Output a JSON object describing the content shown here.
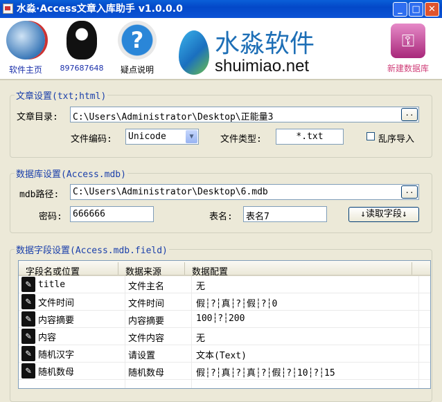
{
  "window": {
    "title": "水淼·Access文章入库助手 v1.0.0.0"
  },
  "header": {
    "items": [
      {
        "label": "软件主页",
        "icon": "globe-icon"
      },
      {
        "label": "897687648",
        "icon": "qq-penguin-icon"
      },
      {
        "label": "疑点说明",
        "icon": "help-icon"
      },
      {
        "label": "新建数据库",
        "icon": "access-key-icon"
      }
    ],
    "logo_cn": "水淼软件",
    "logo_en": "shuimiao.net"
  },
  "article": {
    "legend": "文章设置(txt;html)",
    "dir_label": "文章目录:",
    "dir_value": "C:\\Users\\Administrator\\Desktop\\正能量3",
    "browse": "..",
    "encoding_label": "文件编码:",
    "encoding_value": "Unicode",
    "type_label": "文件类型:",
    "type_value": "*.txt",
    "shuffle_label": "乱序导入"
  },
  "database": {
    "legend": "数据库设置(Access.mdb)",
    "path_label": "mdb路径:",
    "path_value": "C:\\Users\\Administrator\\Desktop\\6.mdb",
    "browse": "..",
    "pwd_label": "密码:",
    "pwd_value": "666666",
    "table_label": "表名:",
    "table_value": "表名7",
    "read_button": "↓读取字段↓"
  },
  "fields": {
    "legend": "数据字段设置(Access.mdb.field)",
    "columns": [
      "字段名或位置",
      "数据来源",
      "数据配置"
    ],
    "rows": [
      {
        "name": "title",
        "source": "文件主名",
        "config": "无"
      },
      {
        "name": "文件时间",
        "source": "文件时间",
        "config": "假┆?┆真┆?┆假┆?┆0"
      },
      {
        "name": "内容摘要",
        "source": "内容摘要",
        "config": "100┆?┆200"
      },
      {
        "name": "内容",
        "source": "文件内容",
        "config": "无"
      },
      {
        "name": "随机汉字",
        "source": "请设置",
        "config": "文本(Text)"
      },
      {
        "name": "随机数母",
        "source": "随机数母",
        "config": "假┆?┆真┆?┆真┆?┆假┆?┆10┆?┆15"
      }
    ]
  }
}
